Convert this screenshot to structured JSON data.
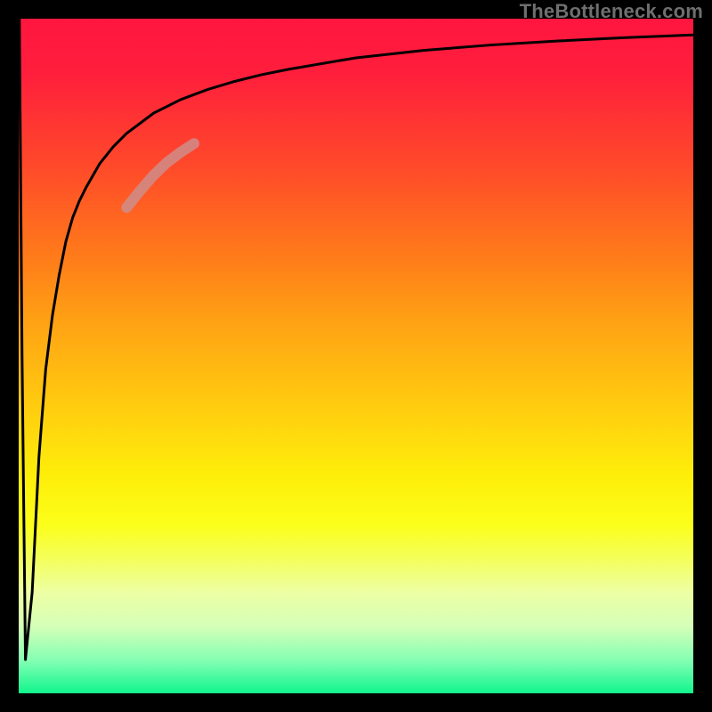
{
  "watermark": "TheBottleneck.com",
  "chart_data": {
    "type": "line",
    "title": "",
    "xlabel": "",
    "ylabel": "",
    "xlim": [
      0,
      100
    ],
    "ylim": [
      0,
      100
    ],
    "grid": false,
    "legend": false,
    "series": [
      {
        "name": "bottleneck-curve",
        "color": "#000000",
        "width": 3,
        "x": [
          0.1,
          0.5,
          1,
          2,
          3,
          4,
          5,
          6,
          7,
          8,
          9,
          10,
          12,
          14,
          16,
          18,
          20,
          24,
          28,
          32,
          36,
          40,
          50,
          60,
          70,
          80,
          90,
          100
        ],
        "y": [
          100,
          50,
          5,
          15,
          35,
          48,
          56,
          62,
          67,
          70.5,
          73,
          75,
          78.5,
          81,
          83,
          84.5,
          86,
          88,
          89.5,
          90.7,
          91.7,
          92.5,
          94.2,
          95.3,
          96.1,
          96.7,
          97.2,
          97.6
        ]
      },
      {
        "name": "highlight-segment",
        "color": "#cf8d8a",
        "width": 12,
        "opacity": 0.85,
        "x": [
          16,
          18,
          20,
          22,
          24,
          26
        ],
        "y": [
          72,
          74.5,
          76.8,
          78.7,
          80.2,
          81.5
        ]
      }
    ],
    "background_gradient": {
      "orientation": "vertical",
      "stops": [
        {
          "pos": 0.0,
          "color": "#ff163f"
        },
        {
          "pos": 0.35,
          "color": "#ff7a1a"
        },
        {
          "pos": 0.68,
          "color": "#feef0a"
        },
        {
          "pos": 0.85,
          "color": "#edffa4"
        },
        {
          "pos": 1.0,
          "color": "#11f58e"
        }
      ]
    }
  }
}
